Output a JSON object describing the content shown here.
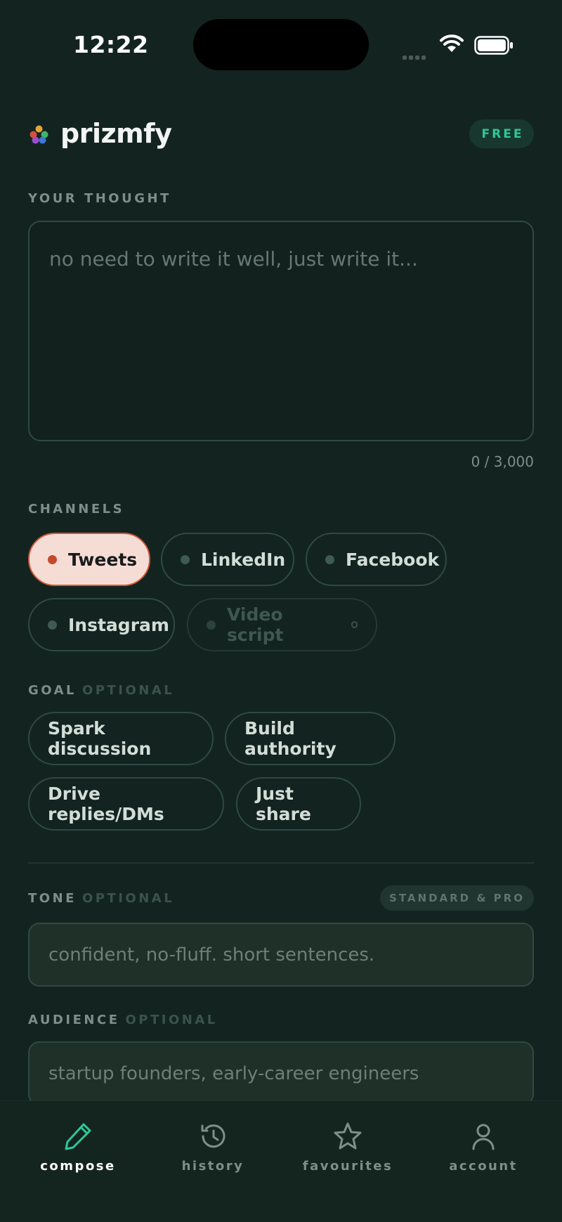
{
  "status_bar": {
    "time": "12:22"
  },
  "header": {
    "brand": "prizmfy",
    "plan_badge": "FREE"
  },
  "thought": {
    "label": "YOUR THOUGHT",
    "placeholder": "no need to write it well, just write it...",
    "value": "",
    "char_count": "0 / 3,000"
  },
  "channels": {
    "label": "CHANNELS",
    "items": [
      {
        "label": "Tweets",
        "selected": true
      },
      {
        "label": "LinkedIn",
        "selected": false
      },
      {
        "label": "Facebook",
        "selected": false
      },
      {
        "label": "Instagram",
        "selected": false
      },
      {
        "label": "Video script",
        "selected": false,
        "disabled": true
      }
    ]
  },
  "goal": {
    "label": "GOAL",
    "optional": "OPTIONAL",
    "items": [
      {
        "label": "Spark discussion"
      },
      {
        "label": "Build authority"
      },
      {
        "label": "Drive replies/DMs"
      },
      {
        "label": "Just share"
      }
    ]
  },
  "tone": {
    "label": "TONE",
    "optional": "OPTIONAL",
    "tier_badge": "STANDARD & PRO",
    "placeholder": "confident, no-fluff. short sentences."
  },
  "audience": {
    "label": "AUDIENCE",
    "optional": "OPTIONAL",
    "placeholder": "startup founders, early-career engineers"
  },
  "nav": {
    "items": [
      {
        "label": "compose",
        "icon": "pencil-icon",
        "active": true
      },
      {
        "label": "history",
        "icon": "history-icon",
        "active": false
      },
      {
        "label": "favourites",
        "icon": "star-icon",
        "active": false
      },
      {
        "label": "account",
        "icon": "user-icon",
        "active": false
      }
    ]
  },
  "colors": {
    "background": "#132420",
    "accent": "#2fc79a",
    "selected_chip_bg": "#f5ddd6",
    "selected_chip_border": "#d05a3a"
  }
}
